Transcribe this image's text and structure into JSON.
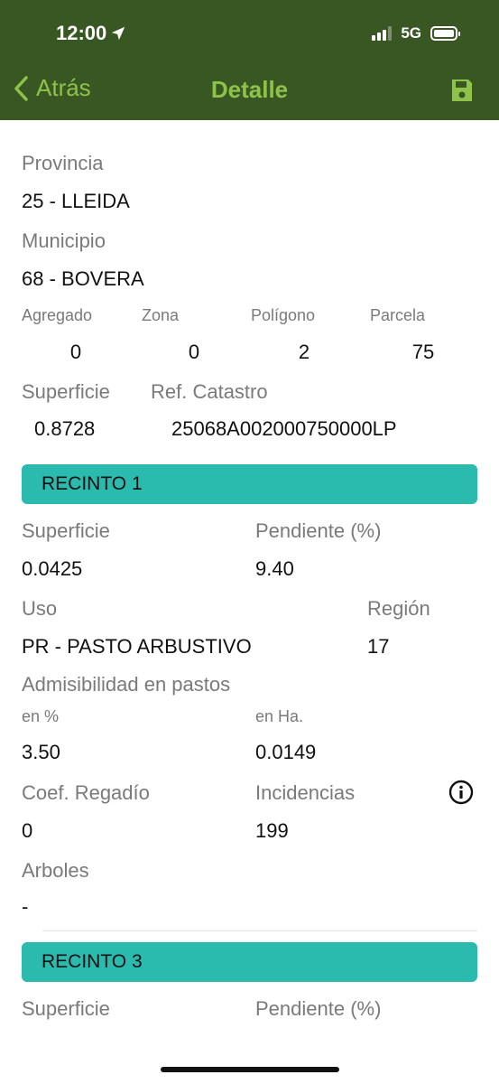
{
  "status": {
    "time": "12:00",
    "network": "5G"
  },
  "nav": {
    "back_label": "Atrás",
    "title": "Detalle",
    "save_icon": "floppy-disk-icon"
  },
  "parcel": {
    "provincia_label": "Provincia",
    "provincia_value": "25 - LLEIDA",
    "municipio_label": "Municipio",
    "municipio_value": "68 - BOVERA",
    "agregado_label": "Agregado",
    "agregado_value": "0",
    "zona_label": "Zona",
    "zona_value": "0",
    "poligono_label": "Polígono",
    "poligono_value": "2",
    "parcela_label": "Parcela",
    "parcela_value": "75",
    "superficie_label": "Superficie",
    "superficie_value": "0.8728",
    "ref_catastro_label": "Ref. Catastro",
    "ref_catastro_value": "25068A002000750000LP"
  },
  "recinto1": {
    "title": "RECINTO 1",
    "superficie_label": "Superficie",
    "superficie_value": "0.0425",
    "pendiente_label": "Pendiente (%)",
    "pendiente_value": "9.40",
    "uso_label": "Uso",
    "uso_value": "PR - PASTO ARBUSTIVO",
    "region_label": "Región",
    "region_value": "17",
    "admisibilidad_label": "Admisibilidad en pastos",
    "en_pct_label": "en %",
    "en_pct_value": "3.50",
    "en_ha_label": "en Ha.",
    "en_ha_value": "0.0149",
    "coef_label": "Coef. Regadío",
    "coef_value": "0",
    "incidencias_label": "Incidencias",
    "incidencias_value": "199",
    "arboles_label": "Arboles",
    "arboles_value": "-"
  },
  "recinto3": {
    "title": "RECINTO 3",
    "superficie_label": "Superficie",
    "pendiente_label": "Pendiente (%)"
  },
  "colors": {
    "header_bg": "#385723",
    "accent_green": "#8fc24a",
    "section_teal": "#2bbaae"
  }
}
